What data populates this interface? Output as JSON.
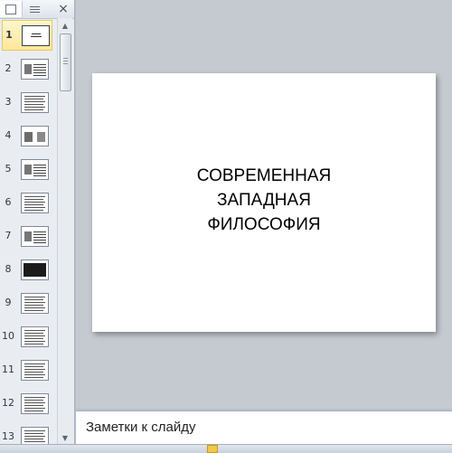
{
  "panel": {
    "tabs": [
      {
        "name": "slides-tab",
        "icon": "slides-icon"
      },
      {
        "name": "outline-tab",
        "icon": "outline-icon"
      }
    ],
    "close_label": "×"
  },
  "thumbnails": [
    {
      "number": "1",
      "selected": true
    },
    {
      "number": "2",
      "selected": false
    },
    {
      "number": "3",
      "selected": false
    },
    {
      "number": "4",
      "selected": false
    },
    {
      "number": "5",
      "selected": false
    },
    {
      "number": "6",
      "selected": false
    },
    {
      "number": "7",
      "selected": false
    },
    {
      "number": "8",
      "selected": false
    },
    {
      "number": "9",
      "selected": false
    },
    {
      "number": "10",
      "selected": false
    },
    {
      "number": "11",
      "selected": false
    },
    {
      "number": "12",
      "selected": false
    },
    {
      "number": "13",
      "selected": false
    }
  ],
  "slide": {
    "title_lines": [
      "СОВРЕМЕННАЯ",
      "ЗАПАДНАЯ",
      "ФИЛОСОФИЯ"
    ]
  },
  "notes": {
    "placeholder": "Заметки к слайду"
  },
  "colors": {
    "selected_thumb": "#ffe79a",
    "workspace": "#c5cad1",
    "panel": "#e9edf2"
  }
}
